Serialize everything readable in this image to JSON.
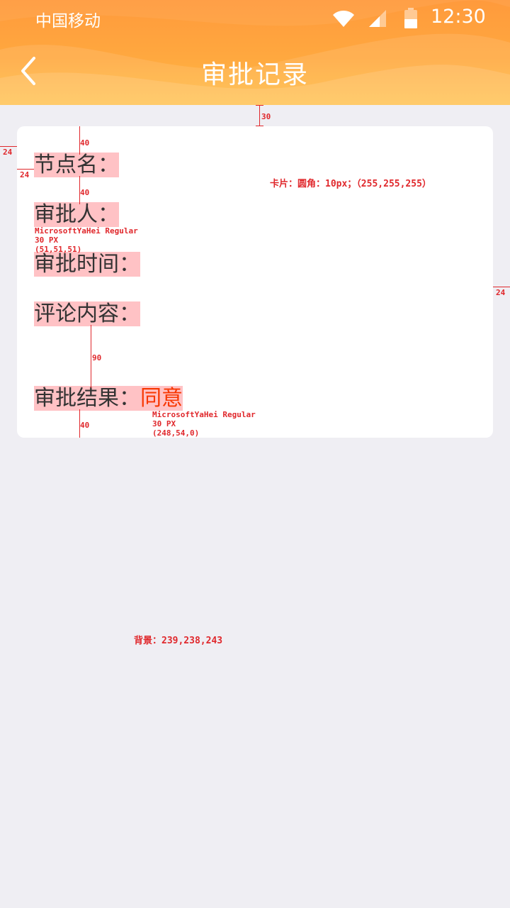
{
  "status_bar": {
    "carrier": "中国移动",
    "time": "12:30"
  },
  "header": {
    "title": "审批记录",
    "back_icon": "chevron-left-icon"
  },
  "colors": {
    "header_gradient_top": "#ff9a3c",
    "header_gradient_bottom": "#ffbe45",
    "background": "#efeef3",
    "card": "#ffffff",
    "text": "#333333",
    "result": "#f83600",
    "annotation": "#e0282c"
  },
  "card": {
    "node_label": "节点名：",
    "approver_label": "审批人：",
    "time_label": "审批时间：",
    "comment_label": "评论内容：",
    "result_label": "审批结果：",
    "result_value": "同意"
  },
  "annotations": {
    "card_spec": "卡片：圆角：10px；（255,255,255）",
    "bg_spec": "背景：239,238,243",
    "font_spec_1": [
      "MicrosoftYaHei Regular",
      "30 PX",
      "(51,51,51)"
    ],
    "font_spec_2": [
      "MicrosoftYaHei Regular",
      "30 PX",
      "(248,54,0)"
    ],
    "dims": {
      "top_gap": "30",
      "card_left": "24",
      "text_left": "24",
      "card_right": "24",
      "top_pad": "40",
      "row_gap": "40",
      "comment_gap": "90",
      "bottom_pad": "40"
    }
  }
}
